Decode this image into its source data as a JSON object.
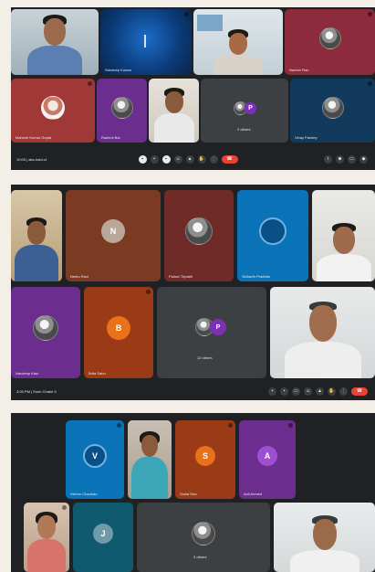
{
  "colors": {
    "background": "#f3efe6",
    "meet_dark": "#202124",
    "tile_grey": "#3c4043",
    "end_call_red": "#ea4335",
    "avatar_brown": "#7a3b22",
    "avatar_orange": "#e8711a",
    "avatar_blue": "#0b74b8",
    "avatar_purple": "#7d2fb5",
    "avatar_maroon": "#8c2b3b"
  },
  "shot1": {
    "tiles": [
      {
        "name": ""
      },
      {
        "name": "Sandeep Kumar"
      },
      {
        "name": ""
      },
      {
        "name": "Naresh Rao"
      },
      {
        "name": "Mahesh Kumar Gupta"
      },
      {
        "name": "Rashmi Bai"
      },
      {
        "name": ""
      },
      {
        "name": "2 others",
        "stack": [
          "",
          "P"
        ]
      },
      {
        "name": "Vinay Pandey"
      }
    ],
    "toolbar": {
      "meet_info": "10:05 | aks-hotd-ct"
    },
    "icons": [
      "mic-icon",
      "camera-icon",
      "captions-icon",
      "emoji-icon",
      "present-icon",
      "raise-hand-icon",
      "more-icon",
      "end-call-icon"
    ]
  },
  "shot2": {
    "tiles": [
      {
        "name": ""
      },
      {
        "name": "Neetu Rani",
        "letter": "N"
      },
      {
        "name": "Pallavi Tripathi"
      },
      {
        "name": "Sidharth Pradhan",
        "letter": ""
      },
      {
        "name": ""
      },
      {
        "name": "Navdeep Kaur"
      },
      {
        "name": "Brita Sahu",
        "letter": "B"
      },
      {
        "name": "12 others",
        "stack": [
          "",
          "P"
        ]
      },
      {
        "name": "Ramesh Dixit (Presenting)"
      }
    ],
    "toolbar": {
      "meet_info": "3:05 PM | Sneh Chakri S"
    }
  },
  "shot3": {
    "tiles": [
      {
        "name": "Vishnu Chauhan",
        "letter": "V"
      },
      {
        "name": ""
      },
      {
        "name": "Sonia Rao",
        "letter": "S"
      },
      {
        "name": "Anil Ahmed",
        "letter": "A"
      },
      {
        "name": ""
      },
      {
        "name": "",
        "letter": "J"
      },
      {
        "name": "3 others"
      },
      {
        "name": ""
      }
    ]
  }
}
